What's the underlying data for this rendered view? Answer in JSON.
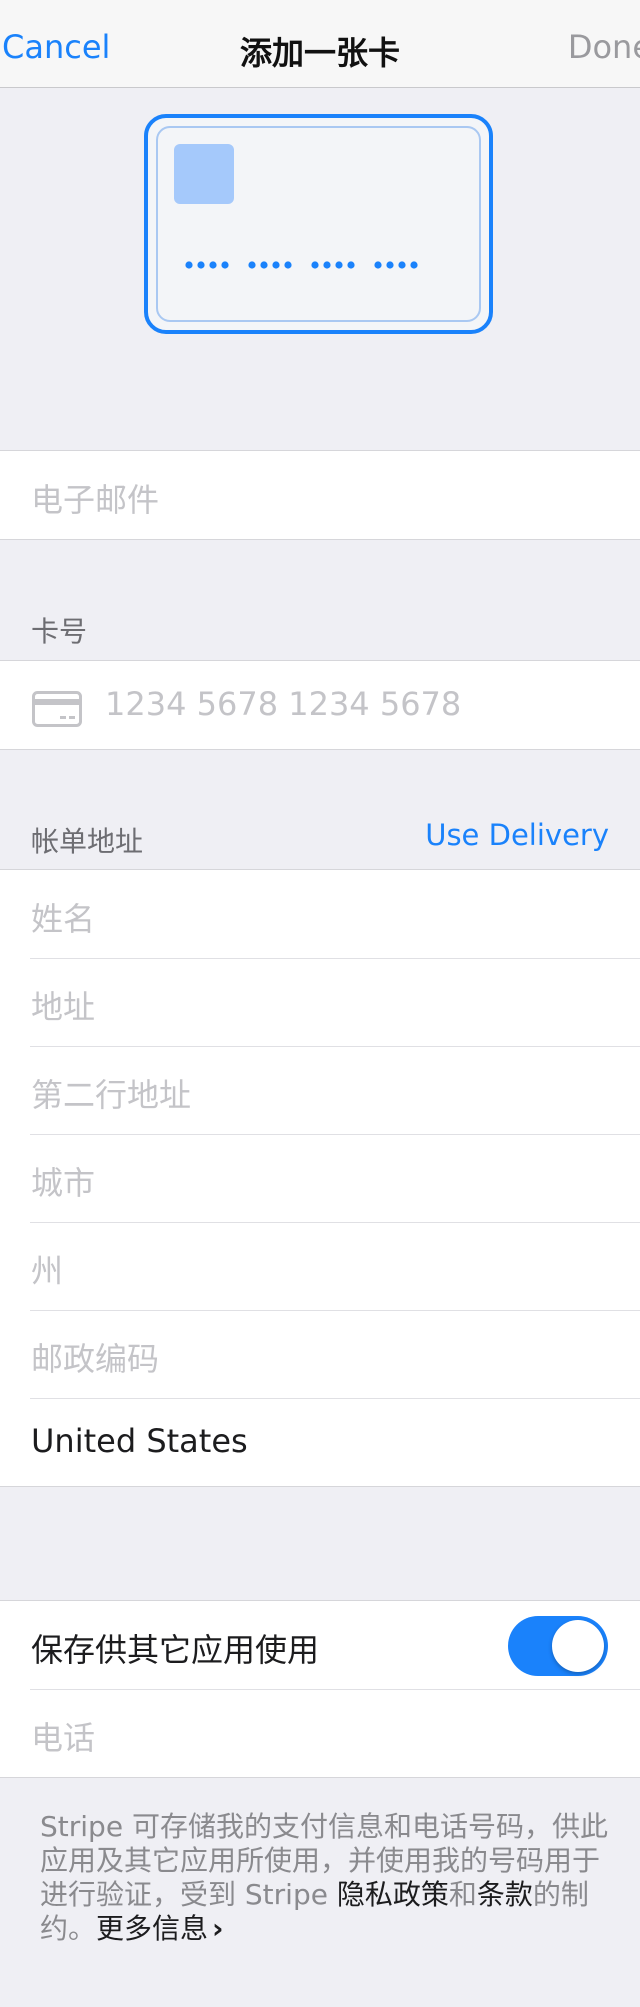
{
  "nav": {
    "cancel": "Cancel",
    "title": "添加一张卡",
    "done": "Done"
  },
  "card_preview": {
    "number_mask": "•••• •••• •••• ••••"
  },
  "email": {
    "placeholder": "电子邮件"
  },
  "card_section": {
    "header": "卡号",
    "number_placeholder": "1234 5678 1234 5678",
    "icon": "credit-card-icon"
  },
  "billing": {
    "header": "帐单地址",
    "use_delivery": "Use Delivery",
    "name_placeholder": "姓名",
    "address_placeholder": "地址",
    "address2_placeholder": "第二行地址",
    "city_placeholder": "城市",
    "state_placeholder": "州",
    "zip_placeholder": "邮政编码",
    "country": "United States"
  },
  "save": {
    "label": "保存供其它应用使用",
    "toggle_on": true,
    "phone_placeholder": "电话"
  },
  "footer": {
    "text_part1": "Stripe 可存储我的支付信息和电话号码，供此应用及其它应用所使用，并使用我的号码用于进行验证，受到 Stripe ",
    "privacy": "隐私政策",
    "and": "和",
    "terms": "条款",
    "text_part2": "的制约。",
    "more": "更多信息",
    "chevron": "›"
  },
  "colors": {
    "accent": "#1a82fb",
    "background": "#efeff4",
    "placeholder": "#c4c4c8"
  }
}
